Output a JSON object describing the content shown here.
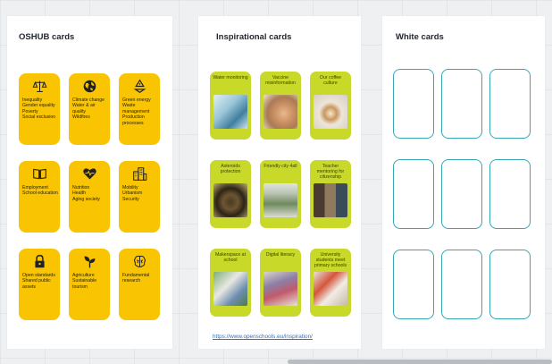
{
  "panels": {
    "oshub": {
      "title": "OSHUB cards",
      "cards": [
        {
          "icon": "scales-icon",
          "items": [
            "Inequality",
            "Gender equality",
            "Poverty",
            "Social exclusion"
          ]
        },
        {
          "icon": "globe-icon",
          "items": [
            "Climate change",
            "Water & air quality",
            "Wildfires"
          ]
        },
        {
          "icon": "recycle-icon",
          "items": [
            "Green energy",
            "Waste management",
            "Production processes"
          ]
        },
        {
          "icon": "book-icon",
          "items": [
            "Employment",
            "School education"
          ]
        },
        {
          "icon": "heart-pulse-icon",
          "items": [
            "Nutrition",
            "Health",
            "Aging society"
          ]
        },
        {
          "icon": "city-icon",
          "items": [
            "Mobility",
            "Urbanism",
            "Security"
          ]
        },
        {
          "icon": "padlock-icon",
          "items": [
            "Open standards",
            "Shared public assets"
          ]
        },
        {
          "icon": "plant-icon",
          "items": [
            "Agriculture",
            "Sustainable tourism"
          ]
        },
        {
          "icon": "brain-icon",
          "items": [
            "Fundamental research"
          ]
        }
      ]
    },
    "inspirational": {
      "title": "Inspirational cards",
      "cards": [
        {
          "label": "Water monitoring",
          "photo": "water-photo"
        },
        {
          "label": "Vaccine misinformation",
          "photo": "vaccine-photo"
        },
        {
          "label": "Our coffee culture",
          "photo": "coffee-photo"
        },
        {
          "label": "Asteroids protection",
          "photo": "asteroid-photo"
        },
        {
          "label": "Friendly city 4all",
          "photo": "city-photo"
        },
        {
          "label": "Teacher mentoring for citizenship",
          "photo": "videocall-photo"
        },
        {
          "label": "Makerspace at school",
          "photo": "makerspace-photo"
        },
        {
          "label": "Digital literacy",
          "photo": "tablet-photo"
        },
        {
          "label": "University students meet primary schools",
          "photo": "classroom-photo"
        }
      ],
      "link": "https://www.openschools.eu/inspiration/"
    },
    "white": {
      "title": "White cards",
      "card_count": 9
    }
  },
  "colors": {
    "oshub_card": "#f9c402",
    "inspirational_card": "#c8d92a",
    "white_card_border": "#36a7b3",
    "link": "#3a6fb5"
  }
}
